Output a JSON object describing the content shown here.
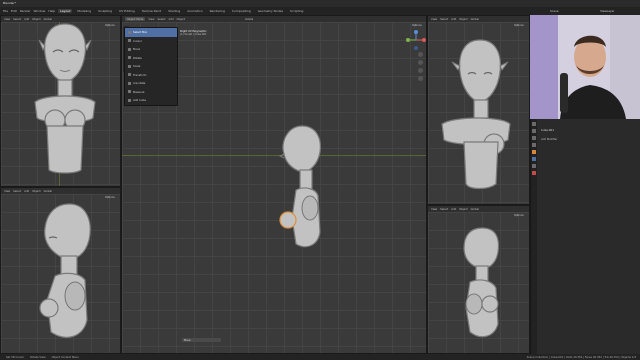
{
  "app": {
    "title": "Blender*"
  },
  "menubar": {
    "menus": [
      "File",
      "Edit",
      "Render",
      "Window",
      "Help"
    ],
    "workspaces": [
      "Layout",
      "Modeling",
      "Sculpting",
      "UV Editing",
      "Texture Paint",
      "Shading",
      "Animation",
      "Rendering",
      "Compositing",
      "Geometry Nodes",
      "Scripting"
    ],
    "active_workspace": "Layout"
  },
  "viewports": {
    "top_left": {
      "header": [
        "View",
        "Select",
        "Add",
        "Object"
      ],
      "mode": "Global",
      "options": "Options"
    },
    "bottom_left": {
      "header": [
        "View",
        "Select",
        "Add",
        "Object"
      ],
      "mode": "Global",
      "options": "Options"
    },
    "center": {
      "mode": "Object Mode",
      "header": [
        "View",
        "Select",
        "Add",
        "Object"
      ],
      "transform": "Global",
      "options": "Options",
      "overlay_title": "Right Orthographic",
      "overlay_sub": "(1) Sculpt | Cube.001"
    },
    "top_right": {
      "header": [
        "View",
        "Select",
        "Add",
        "Object"
      ],
      "mode": "Global",
      "options": "Options"
    },
    "bottom_right": {
      "header": [
        "View",
        "Select",
        "Add",
        "Object"
      ],
      "mode": "Global",
      "options": "Options"
    }
  },
  "tool_menu": {
    "items": [
      {
        "label": "Select Box",
        "selected": true
      },
      {
        "label": "Cursor",
        "selected": false
      },
      {
        "label": "Move",
        "selected": false
      },
      {
        "label": "Rotate",
        "selected": false
      },
      {
        "label": "Scale",
        "selected": false
      },
      {
        "label": "Transform",
        "selected": false
      },
      {
        "label": "Annotate",
        "selected": false
      },
      {
        "label": "Measure",
        "selected": false
      },
      {
        "label": "Add Cube",
        "selected": false
      }
    ]
  },
  "top_right_bar": {
    "scene": "Scene",
    "view_layer": "ViewLayer"
  },
  "properties": {
    "object_name": "Cube.001",
    "section": "Add Modifier"
  },
  "center_footer": {
    "label": "Move"
  },
  "status_bar": {
    "left": [
      "Set 3D Cursor",
      "Rotate View",
      "Object Context Menu"
    ],
    "right": "Scene Collection | Cube.001 | Verts 20,354 | Faces 20,352 | Tris 40,704 | Objects 1/3"
  },
  "colors": {
    "accent": "#4f6fa5",
    "selection": "#e0903a",
    "viewport_bg": "#3a3a3a"
  }
}
